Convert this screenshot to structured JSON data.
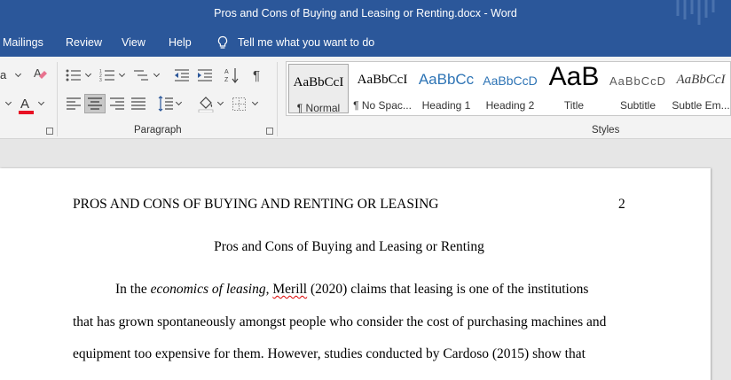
{
  "window": {
    "title": "Pros and Cons of Buying and Leasing or Renting.docx  -  Word"
  },
  "tabs": [
    "Mailings",
    "Review",
    "View",
    "Help"
  ],
  "tell_me": {
    "placeholder": "Tell me what you want to do",
    "icon": "lightbulb-icon"
  },
  "font_group": {
    "partial_label": "a"
  },
  "paragraph_group": {
    "label": "Paragraph"
  },
  "styles_group": {
    "label": "Styles",
    "items": [
      {
        "sample": "AaBbCcI",
        "name": "¶ Normal",
        "active": true
      },
      {
        "sample": "AaBbCcI",
        "name": "¶ No Spac..."
      },
      {
        "sample": "AaBbCc",
        "name": "Heading 1"
      },
      {
        "sample": "AaBbCcD",
        "name": "Heading 2"
      },
      {
        "sample": "AaB",
        "name": "Title"
      },
      {
        "sample": "AaBbCcD",
        "name": "Subtitle"
      },
      {
        "sample": "AaBbCcI",
        "name": "Subtle Em..."
      }
    ]
  },
  "colors": {
    "title_bar": "#2b579a",
    "heading_blue": "#2e74b5",
    "font_color_red": "#e81123",
    "spelling_underline": "#d00000"
  },
  "document": {
    "running_head": "PROS AND CONS OF BUYING AND RENTING OR LEASING",
    "page_number": "2",
    "title": "Pros and Cons of Buying and Leasing or Renting",
    "lines": {
      "l1_a": "In the ",
      "l1_italic": "economics of leasing",
      "l1_b": ", ",
      "l1_name": "Merill",
      "l1_c": " (2020) claims that leasing is one of the institutions",
      "l2": "that has grown spontaneously amongst people who consider the cost of purchasing machines and",
      "l3": "equipment too expensive for them. However, studies conducted by Cardoso (2015) show that"
    }
  }
}
